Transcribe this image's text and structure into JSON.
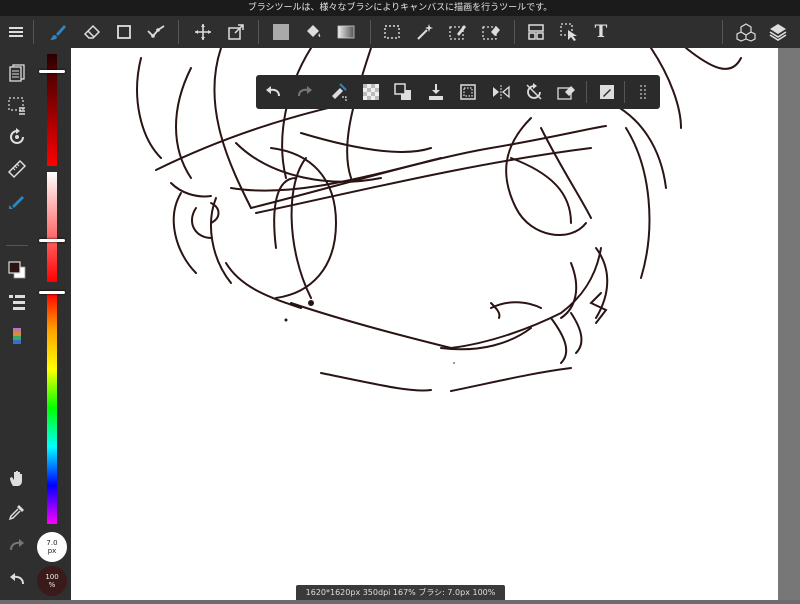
{
  "hint": {
    "text": "ブラシツールは、様々なブラシによりキャンバスに描画を行うツールです。"
  },
  "toolbar": {
    "text_tool_label": "T",
    "icons": [
      "menu-icon",
      "brush-icon",
      "eraser-icon",
      "shape-icon",
      "dot-tool-icon",
      "move-icon",
      "transform-icon",
      "fill-color-icon",
      "bucket-icon",
      "gradient-icon",
      "select-rect-icon",
      "magic-wand-icon",
      "select-pen-icon",
      "select-eraser-icon",
      "frame-icon",
      "operate-icon",
      "text-icon",
      "3d-icon",
      "layers-icon"
    ]
  },
  "float_toolbar": {
    "icons": [
      "undo-icon",
      "redo-icon",
      "clear-selection-icon",
      "transparent-icon",
      "swap-colors-icon",
      "download-icon",
      "crop-icon",
      "flip-icon",
      "rotate-off-icon",
      "eraser-select-icon",
      "edit-icon",
      "grip-icon"
    ]
  },
  "left_tools": {
    "icons": [
      "pages-icon",
      "layer-select-icon",
      "rotate-icon",
      "ruler-icon",
      "pen-active-icon",
      "color-swatch-icon",
      "list-icon",
      "palette-icon",
      "hand-icon",
      "eyedropper-icon",
      "redo-left-icon",
      "undo-left-icon"
    ]
  },
  "brush": {
    "size_value": "7.0",
    "size_unit": "px"
  },
  "opacity": {
    "value": "100",
    "unit": "%"
  },
  "status": {
    "text": "1620*1620px 350dpi 167% ブラシ: 7.0px 100%"
  },
  "colors": {
    "accent": "#2e86c1",
    "stroke": "#2a1414",
    "panel": "#2f2f2f"
  }
}
